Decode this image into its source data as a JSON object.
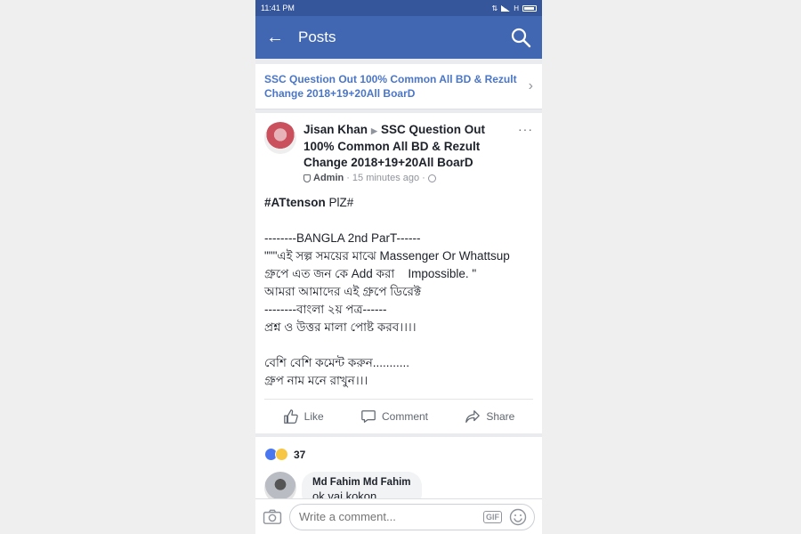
{
  "status_bar": {
    "time": "11:41 PM",
    "network": "H"
  },
  "navbar": {
    "back_icon": "←",
    "title": "Posts"
  },
  "group_link": {
    "text": "SSC Question Out 100% Common All BD & Rezult Change 2018+19+20All BoarD"
  },
  "post": {
    "author": "Jisan Khan",
    "group": "SSC Question Out 100% Common All BD & Rezult Change 2018+19+20All BoarD",
    "role": "Admin",
    "time": "15 minutes ago",
    "more": "···",
    "body": {
      "hashtag": "#ATtenson",
      "hashtag_rest": " PlZ#",
      "lines": [
        "",
        "--------BANGLA 2nd ParT------",
        "\"\"\"এই সল্প সময়ের মাঝে Massenger Or Whattsup",
        "গ্রুপে এত জন কে Add করা    Impossible. \"",
        "আমরা আমাদের এই গ্রুপে ডিরেক্ট",
        "--------বাংলা ২য় পত্র------",
        "প্রশ্ন ও উত্তর মালা পোষ্ট করব।।।।",
        "",
        "বেশি বেশি কমেন্ট করুন...........",
        "গ্রুপ নাম মনে রাখুন।।।"
      ]
    },
    "actions": {
      "like": "Like",
      "comment": "Comment",
      "share": "Share"
    },
    "reactions": {
      "count": "37"
    }
  },
  "comment": {
    "name": "Md Fahim Md Fahim",
    "text": "ok vai kokon"
  },
  "comment_bar": {
    "placeholder": "Write a comment...",
    "gif": "GIF"
  },
  "colors": {
    "header": "#4267b2",
    "status_bar": "#35569b",
    "link": "#4a76c8"
  }
}
